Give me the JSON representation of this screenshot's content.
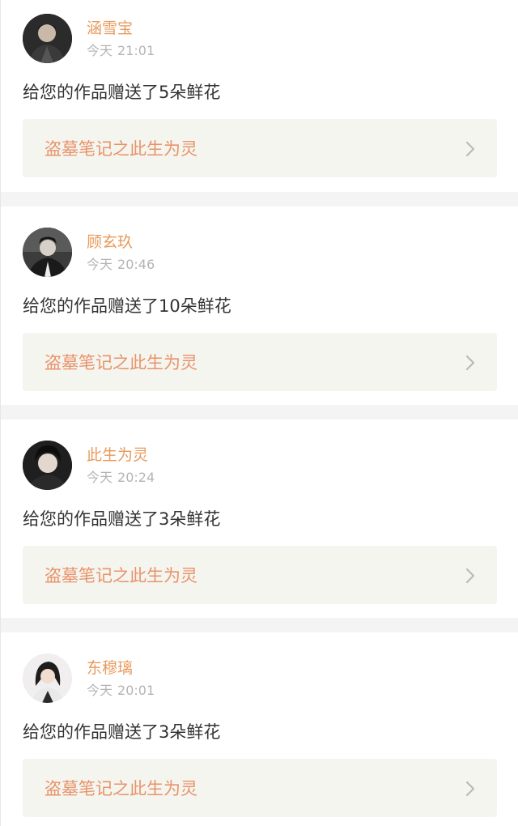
{
  "notifications": [
    {
      "username": "涵雪宝",
      "time_day": "今天",
      "time_clock": "21:01",
      "message": "给您的作品赠送了5朵鲜花",
      "work_title": "盗墓笔记之此生为灵",
      "avatar_icon": "user-avatar-icon",
      "chevron_icon": "chevron-right-icon"
    },
    {
      "username": "顾玄玖",
      "time_day": "今天",
      "time_clock": "20:46",
      "message": "给您的作品赠送了10朵鲜花",
      "work_title": "盗墓笔记之此生为灵",
      "avatar_icon": "user-avatar-icon",
      "chevron_icon": "chevron-right-icon"
    },
    {
      "username": "此生为灵",
      "time_day": "今天",
      "time_clock": "20:24",
      "message": "给您的作品赠送了3朵鲜花",
      "work_title": "盗墓笔记之此生为灵",
      "avatar_icon": "user-avatar-icon",
      "chevron_icon": "chevron-right-icon"
    },
    {
      "username": "东穆璃",
      "time_day": "今天",
      "time_clock": "20:01",
      "message": "给您的作品赠送了3朵鲜花",
      "work_title": "盗墓笔记之此生为灵",
      "avatar_icon": "user-avatar-icon",
      "chevron_icon": "chevron-right-icon"
    }
  ],
  "colors": {
    "username": "#e89a5c",
    "work_title": "#e8936a",
    "timestamp": "#b4b4b4",
    "message": "#333333",
    "work_card_bg": "#f5f5ef",
    "separator": "#f4f4f4"
  }
}
